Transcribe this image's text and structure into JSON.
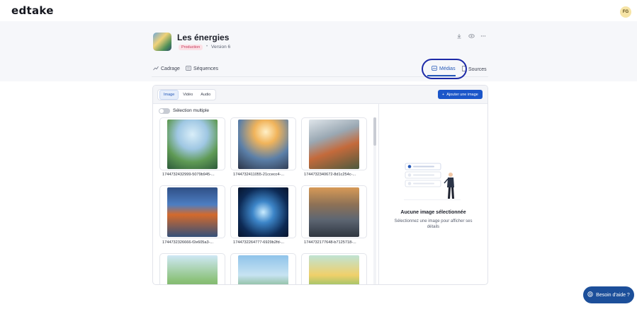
{
  "app": {
    "logo": "edtake",
    "avatar_initials": "FG"
  },
  "project": {
    "title": "Les énergies",
    "status_badge": "Production",
    "separator": "•",
    "version": "Version 6"
  },
  "header_actions": [
    {
      "icon": "download-icon"
    },
    {
      "icon": "eye-icon"
    },
    {
      "icon": "more-icon"
    }
  ],
  "tabs": {
    "cadrage": "Cadrage",
    "sequences": "Séquences",
    "medias": "Médias",
    "sources": "Sources"
  },
  "media": {
    "segments": [
      "Image",
      "Vidéo",
      "Audio"
    ],
    "active_segment": "Image",
    "add_button": "Ajouter une image",
    "multi_select_label": "Sélection multiple",
    "files": [
      "1744732432999-5079b945-...",
      "1744732411055-21ccecc4-...",
      "1744732340672-8d1c254c-...",
      "1744732326666-f2e605a3-...",
      "1744732264777-6929b2fd-...",
      "1744732177648-b7125718-..."
    ]
  },
  "empty_state": {
    "title": "Aucune image sélectionnée",
    "description": "Sélectionnez une image pour afficher ses détails"
  },
  "help": {
    "label": "Besoin d'aide ?"
  },
  "colors": {
    "accent": "#2458b8",
    "primary_button": "#1b56c9",
    "help_button": "#1c4f9a",
    "highlight_ring": "#1d2aa8",
    "badge_text": "#c8365a"
  }
}
